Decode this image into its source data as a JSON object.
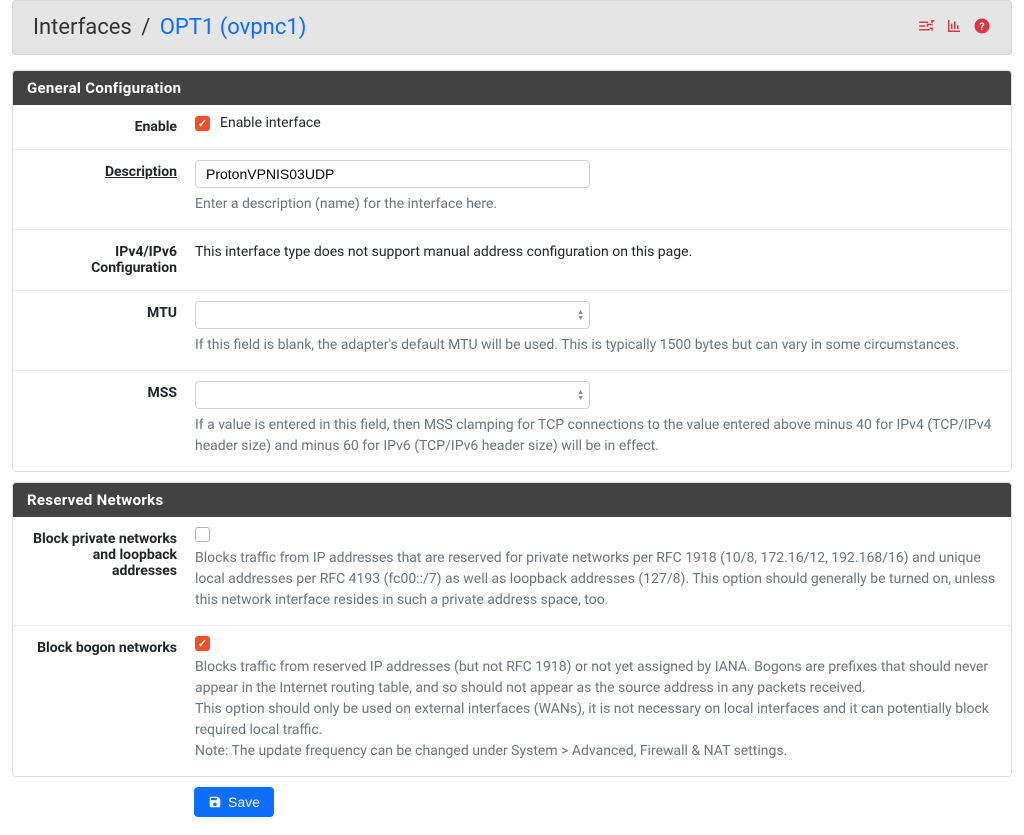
{
  "breadcrumb": {
    "root": "Interfaces",
    "current": "OPT1 (ovpnc1)"
  },
  "panels": {
    "general": {
      "title": "General Configuration",
      "enable": {
        "label": "Enable",
        "checkbox_label": "Enable interface",
        "checked": true
      },
      "description": {
        "label": "Description",
        "value": "ProtonVPNIS03UDP",
        "help": "Enter a description (name) for the interface here."
      },
      "ipconfig": {
        "label": "IPv4/IPv6 Configuration",
        "text": "This interface type does not support manual address configuration on this page."
      },
      "mtu": {
        "label": "MTU",
        "value": "",
        "help": "If this field is blank, the adapter's default MTU will be used. This is typically 1500 bytes but can vary in some circumstances."
      },
      "mss": {
        "label": "MSS",
        "value": "",
        "help": "If a value is entered in this field, then MSS clamping for TCP connections to the value entered above minus 40 for IPv4 (TCP/IPv4 header size) and minus 60 for IPv6 (TCP/IPv6 header size) will be in effect."
      }
    },
    "reserved": {
      "title": "Reserved Networks",
      "block_private": {
        "label": "Block private networks and loopback addresses",
        "checked": false,
        "help": "Blocks traffic from IP addresses that are reserved for private networks per RFC 1918 (10/8, 172.16/12, 192.168/16) and unique local addresses per RFC 4193 (fc00::/7) as well as loopback addresses (127/8). This option should generally be turned on, unless this network interface resides in such a private address space, too."
      },
      "block_bogon": {
        "label": "Block bogon networks",
        "checked": true,
        "help1": "Blocks traffic from reserved IP addresses (but not RFC 1918) or not yet assigned by IANA. Bogons are prefixes that should never appear in the Internet routing table, and so should not appear as the source address in any packets received.",
        "help2": "This option should only be used on external interfaces (WANs), it is not necessary on local interfaces and it can potentially block required local traffic.",
        "help3": "Note: The update frequency can be changed under System > Advanced, Firewall & NAT settings."
      }
    }
  },
  "buttons": {
    "save": "Save"
  }
}
